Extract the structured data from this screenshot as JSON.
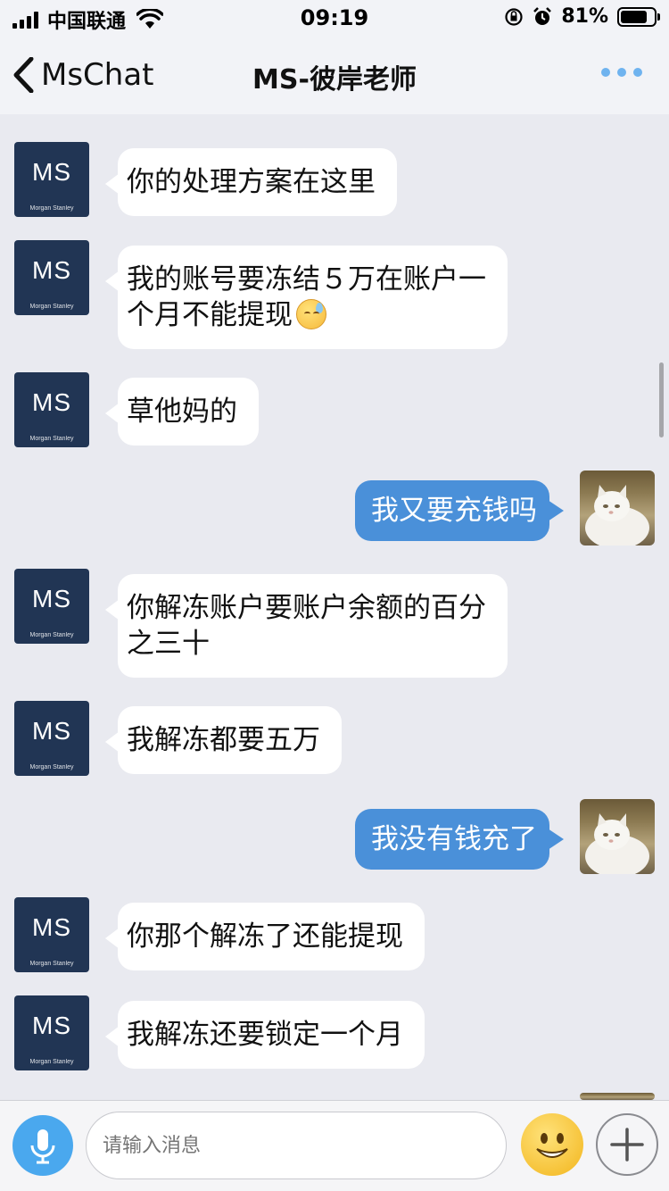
{
  "status_bar": {
    "carrier": "中国联通",
    "time": "09:19",
    "battery_percent": "81%",
    "battery_level": 0.81,
    "icons": [
      "signal-icon",
      "wifi-icon",
      "rotation-lock-icon",
      "alarm-icon",
      "battery-icon"
    ]
  },
  "nav": {
    "back_label": "MsChat",
    "title": "MS-彼岸老师",
    "more_icon": "more-dots-icon"
  },
  "avatar": {
    "ms_logo": "MS",
    "ms_subtitle": "Morgan Stanley"
  },
  "messages": [
    {
      "side": "in",
      "text": "你的处理方案在这里"
    },
    {
      "side": "in",
      "text": "我的账号要冻结５万在账户一",
      "text2": "个月不能提现",
      "emoji": "sweat-emoji"
    },
    {
      "side": "in",
      "text": "草他妈的"
    },
    {
      "side": "out",
      "text": "我又要充钱吗"
    },
    {
      "side": "in",
      "text": "你解冻账户要账户余额的百分",
      "text2": "之三十"
    },
    {
      "side": "in",
      "text": "我解冻都要五万"
    },
    {
      "side": "out",
      "text": "我没有钱充了"
    },
    {
      "side": "in",
      "text": "你那个解冻了还能提现"
    },
    {
      "side": "in",
      "text": "我解冻还要锁定一个月"
    }
  ],
  "input_bar": {
    "placeholder": "请输入消息",
    "mic_icon": "microphone-icon",
    "emoji_icon": "smiley-icon",
    "plus_icon": "plus-icon"
  },
  "colors": {
    "background": "#e9eaf0",
    "bar": "#f2f3f7",
    "outgoing_bubble": "#4a90d9",
    "incoming_bubble": "#ffffff",
    "ms_avatar": "#213554",
    "accent": "#4aa8ee"
  }
}
